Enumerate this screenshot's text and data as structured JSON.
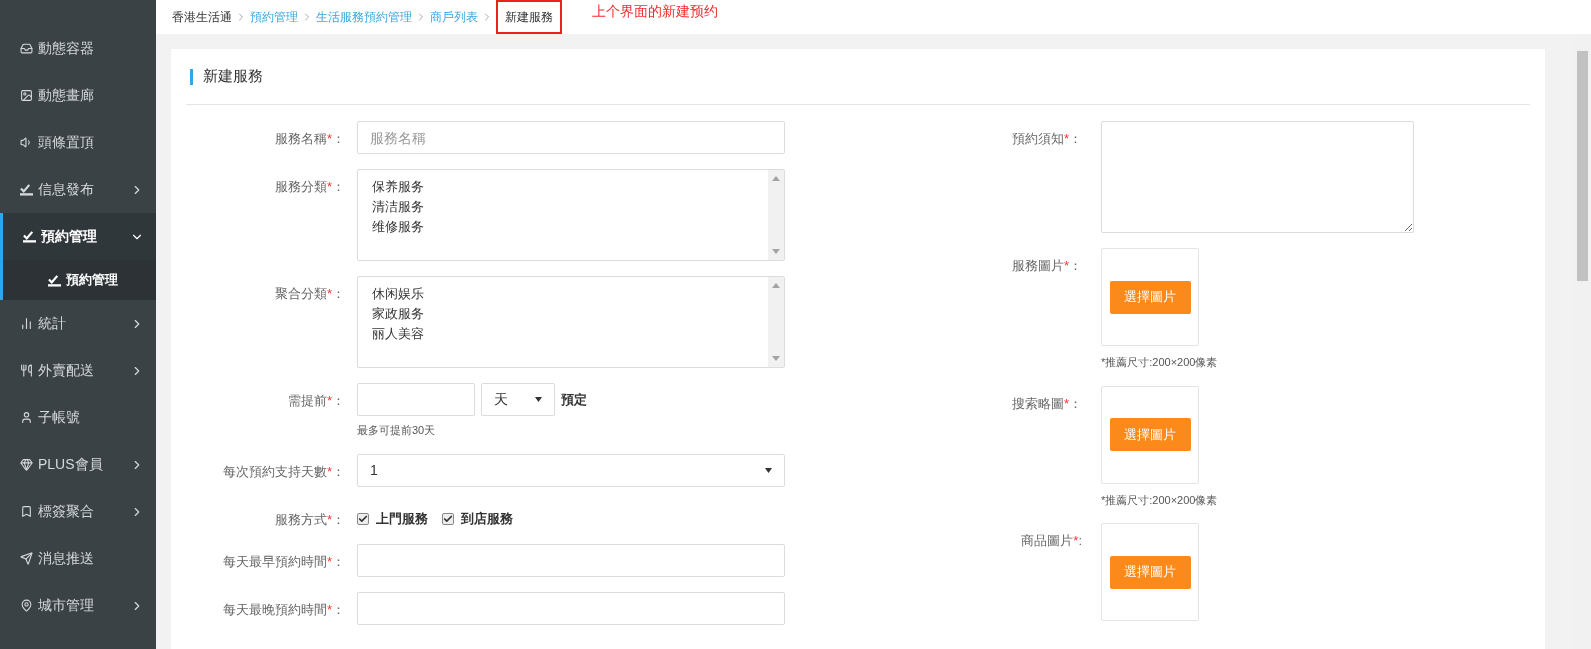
{
  "sidebar": {
    "items": [
      {
        "label": "動態容器",
        "kind": "link",
        "selected": false
      },
      {
        "label": "動態畫廊",
        "kind": "link",
        "selected": false
      },
      {
        "label": "頭條置頂",
        "kind": "link",
        "selected": false
      },
      {
        "label": "信息發布",
        "kind": "group",
        "expanded": false,
        "selected": false
      },
      {
        "label": "預約管理",
        "kind": "group",
        "expanded": true,
        "selected": true,
        "children": [
          {
            "label": "預約管理",
            "selected": true
          }
        ]
      },
      {
        "label": "統計",
        "kind": "group",
        "expanded": false,
        "selected": false
      },
      {
        "label": "外賣配送",
        "kind": "group",
        "expanded": false,
        "selected": false
      },
      {
        "label": "子帳號",
        "kind": "link",
        "selected": false
      },
      {
        "label": "PLUS會員",
        "kind": "group",
        "expanded": false,
        "selected": false
      },
      {
        "label": "標簽聚合",
        "kind": "group",
        "expanded": false,
        "selected": false
      },
      {
        "label": "消息推送",
        "kind": "link",
        "selected": false
      },
      {
        "label": "城市管理",
        "kind": "group",
        "expanded": false,
        "selected": false
      }
    ]
  },
  "breadcrumb": [
    {
      "label": "香港生活通",
      "kind": "home"
    },
    {
      "label": "預約管理",
      "kind": "link"
    },
    {
      "label": "生活服務預約管理",
      "kind": "link"
    },
    {
      "label": "商戶列表",
      "kind": "link"
    },
    {
      "label": "新建服務",
      "kind": "current",
      "highlighted": true
    }
  ],
  "annotation": "上个界面的新建预约",
  "card": {
    "title": "新建服務"
  },
  "left_fields": [
    {
      "kind": "text",
      "label": "服務名稱",
      "required_mark": "*",
      "colon": "：",
      "placeholder": "服務名稱"
    },
    {
      "kind": "listbox",
      "label": "服務分類",
      "required_mark": "*",
      "colon": "：",
      "options": [
        "保养服务",
        "清洁服务",
        "维修服务"
      ]
    },
    {
      "kind": "listbox",
      "label": "聚合分類",
      "required_mark": "*",
      "colon": "：",
      "options": [
        "休闲娱乐",
        "家政服务",
        "丽人美容"
      ]
    },
    {
      "kind": "advance",
      "label": "需提前",
      "required_mark": "*",
      "colon": "：",
      "unit": "天",
      "suffix": "預定",
      "hint": "最多可提前30天"
    },
    {
      "kind": "select",
      "label": "每次預約支持天數",
      "required_mark": "*",
      "colon": "：",
      "value": "1"
    },
    {
      "kind": "checkboxes",
      "label": "服務方式",
      "required_mark": "*",
      "colon": "：",
      "options": [
        {
          "label": "上門服務",
          "checked": true
        },
        {
          "label": "到店服務",
          "checked": true
        }
      ]
    },
    {
      "kind": "text",
      "label": "每天最早預約時間",
      "required_mark": "*",
      "colon": "："
    },
    {
      "kind": "text",
      "label": "每天最晚預約時間",
      "required_mark": "*",
      "colon": "："
    }
  ],
  "right_fields": [
    {
      "kind": "textarea",
      "label": "預約須知",
      "required_mark": "*",
      "colon": "："
    },
    {
      "kind": "image",
      "label": "服務圖片",
      "required_mark": "*",
      "colon": "：",
      "button": "選擇圖片",
      "hint": "*推薦尺寸:200×200像素"
    },
    {
      "kind": "image",
      "label": "搜索略圖",
      "required_mark": "*",
      "colon": "：",
      "button": "選擇圖片",
      "hint": "*推薦尺寸:200×200像素"
    },
    {
      "kind": "image",
      "label": "商品圖片",
      "required_mark": "*",
      "colon": ":",
      "button": "選擇圖片"
    }
  ]
}
